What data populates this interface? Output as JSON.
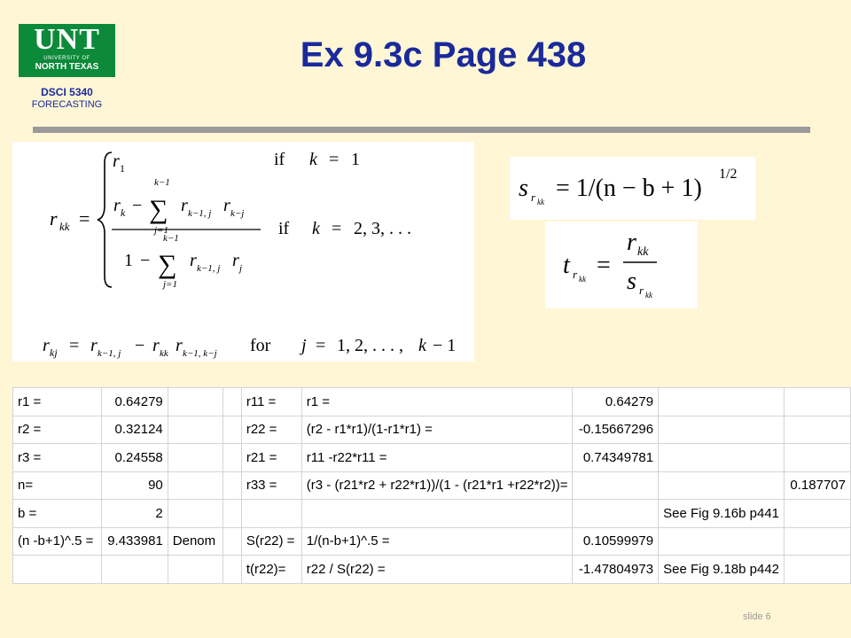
{
  "header": {
    "logo_main": "UNT",
    "logo_line1": "UNIVERSITY OF",
    "logo_line2": "NORTH TEXAS",
    "course_code": "DSCI 5340",
    "course_name": "FORECASTING",
    "title": "Ex 9.3c Page 438"
  },
  "footer": {
    "slide_number": "slide 6"
  },
  "formulas": {
    "rkk": {
      "lhs_r": "r",
      "lhs_sub": "kk",
      "eq": "=",
      "case1_r": "r",
      "case1_sub": "1",
      "case1_if": "if",
      "case1_k": "k",
      "case1_eq": "=",
      "case1_val": "1",
      "num_r": "r",
      "num_sub": "k",
      "num_minus": "−",
      "sum_top": "k−1",
      "sum_bottom": "j=1",
      "sum_sym": "∑",
      "num_term1": "r",
      "num_term1_sub": "k−1, j",
      "num_term2": "r",
      "num_term2_sub": "k−j",
      "den_one": "1",
      "den_minus": "−",
      "den_sum_top": "k−1",
      "den_sum_bottom": "j=1",
      "den_term1": "r",
      "den_term1_sub": "k−1, j",
      "den_term2": "r",
      "den_term2_sub": "j",
      "case2_if": "if",
      "case2_k": "k",
      "case2_eq": "=",
      "case2_vals": "2, 3, . . .",
      "rkj_r": "r",
      "rkj_sub": "kj",
      "rkj_eq": "=",
      "rkj_t1": "r",
      "rkj_t1_sub": "k−1, j",
      "rkj_minus": "−",
      "rkj_t2": "r",
      "rkj_t2_sub": "kk",
      "rkj_t3": "r",
      "rkj_t3_sub": "k−1, k−j",
      "rkj_for": "for",
      "rkj_j": "j",
      "rkj_jeq": "=",
      "rkj_range": "1, 2, . . . ,",
      "rkj_k": "k",
      "rkj_end": "− 1"
    },
    "srkk": {
      "s": "s",
      "sub_r": "r",
      "sub_kk": "kk",
      "rhs": "= 1/(n − b + 1)",
      "exp": "1/2"
    },
    "trkk": {
      "t": "t",
      "sub_r": "r",
      "sub_kk": "kk",
      "eq": "=",
      "num_r": "r",
      "num_sub": "kk",
      "den_s": "s",
      "den_sub_r": "r",
      "den_sub_kk": "kk"
    }
  },
  "spreadsheet": {
    "rows": [
      [
        "r1 =",
        "0.64279",
        "",
        "",
        "r11 =",
        "r1 =",
        "0.64279",
        "",
        ""
      ],
      [
        "r2 =",
        "0.32124",
        "",
        "",
        "r22 =",
        "(r2 - r1*r1)/(1-r1*r1) =",
        "-0.15667296",
        "",
        ""
      ],
      [
        "r3 =",
        "0.24558",
        "",
        "",
        "r21 =",
        "r11 -r22*r11 =",
        "0.74349781",
        "",
        ""
      ],
      [
        "n=",
        "90",
        "",
        "",
        "r33 =",
        "(r3 - (r21*r2 + r22*r1))/(1 - (r21*r1 +r22*r2))=",
        "",
        "",
        "0.187707"
      ],
      [
        "b =",
        "2",
        "",
        "",
        "",
        "",
        "",
        "See Fig 9.16b p441",
        ""
      ],
      [
        "(n -b+1)^.5 =",
        "9.433981",
        "Denom",
        "",
        "S(r22) =",
        "1/(n-b+1)^.5 =",
        "0.10599979",
        "",
        ""
      ],
      [
        "",
        "",
        "",
        "",
        "t(r22)=",
        "r22 / S(r22) =",
        "-1.47804973",
        "See Fig 9.18b p442",
        ""
      ]
    ]
  }
}
